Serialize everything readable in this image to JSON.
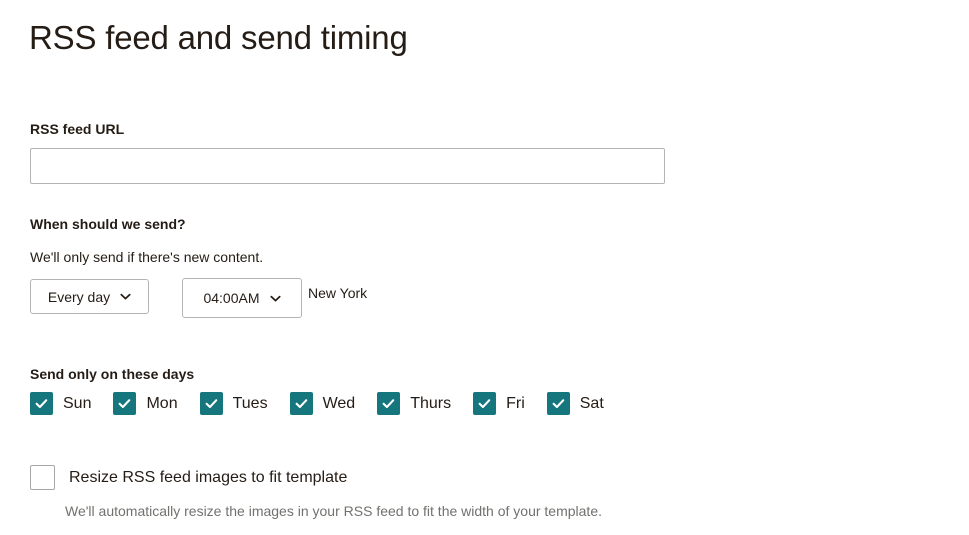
{
  "page": {
    "title": "RSS feed and send timing"
  },
  "rss_feed": {
    "label": "RSS feed URL",
    "value": "",
    "placeholder": ""
  },
  "send_timing": {
    "heading": "When should we send?",
    "subtext": "We'll only send if there's new content.",
    "frequency_select": {
      "value": "Every day",
      "icon": "chevron-down-icon"
    },
    "time_select": {
      "value": "04:00AM",
      "icon": "chevron-down-icon"
    },
    "timezone": "New York"
  },
  "days": {
    "heading": "Send only on these days",
    "items": [
      {
        "label": "Sun",
        "checked": true
      },
      {
        "label": "Mon",
        "checked": true
      },
      {
        "label": "Tues",
        "checked": true
      },
      {
        "label": "Wed",
        "checked": true
      },
      {
        "label": "Thurs",
        "checked": true
      },
      {
        "label": "Fri",
        "checked": true
      },
      {
        "label": "Sat",
        "checked": true
      }
    ]
  },
  "resize_option": {
    "label": "Resize RSS feed images to fit template",
    "checked": false,
    "help_text": "We'll automatically resize the images in your RSS feed to fit the width of your template."
  },
  "colors": {
    "accent_teal": "#15767e",
    "text": "#241c15",
    "muted_text": "#73716e",
    "border": "#b4b4b4",
    "background": "#ffffff"
  }
}
